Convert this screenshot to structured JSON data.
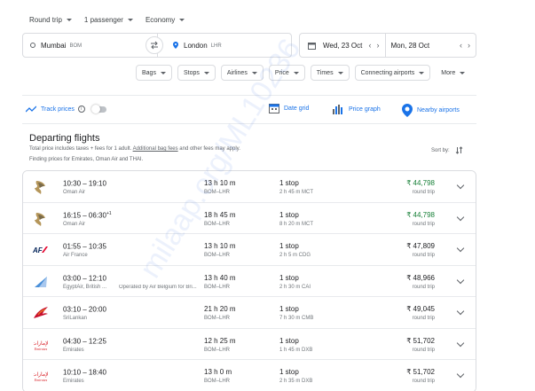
{
  "trip": {
    "type": "Round trip",
    "passengers": "1 passenger",
    "cabin": "Economy"
  },
  "search": {
    "origin_city": "Mumbai",
    "origin_code": "BOM",
    "dest_city": "London",
    "dest_code": "LHR",
    "depart_date": "Wed, 23 Oct",
    "return_date": "Mon, 28 Oct"
  },
  "filters": [
    "Bags",
    "Stops",
    "Airlines",
    "Price",
    "Times",
    "Connecting airports"
  ],
  "more_label": "More",
  "tools": {
    "track_prices": "Track prices",
    "date_grid": "Date grid",
    "price_graph": "Price graph",
    "nearby_airports": "Nearby airports"
  },
  "results": {
    "heading": "Departing flights",
    "note_prefix": "Total price includes taxes + fees for 1 adult.",
    "note_link": "Additional bag fees",
    "note_suffix": "and other fees may apply.",
    "note2": "Finding prices for Emirates, Oman Air and THAI.",
    "sort_label": "Sort by:"
  },
  "flights": [
    {
      "time": "10:30 – 19:10",
      "plus": "",
      "airline": "Oman Air",
      "operated": "",
      "duration": "13 h 10 m",
      "route": "BOM–LHR",
      "stops": "1 stop",
      "layover": "2 h 45 m MCT",
      "price": "₹ 44,798",
      "low": true,
      "price_note": "round trip",
      "logo": "omanair"
    },
    {
      "time": "16:15 – 06:30",
      "plus": "+1",
      "airline": "Oman Air",
      "operated": "",
      "duration": "18 h 45 m",
      "route": "BOM–LHR",
      "stops": "1 stop",
      "layover": "8 h 20 m MCT",
      "price": "₹ 44,798",
      "low": true,
      "price_note": "round trip",
      "logo": "omanair"
    },
    {
      "time": "01:55 – 10:35",
      "plus": "",
      "airline": "Air France",
      "operated": "",
      "duration": "13 h 10 m",
      "route": "BOM–LHR",
      "stops": "1 stop",
      "layover": "2 h 5 m CDG",
      "price": "₹ 47,809",
      "low": false,
      "price_note": "round trip",
      "logo": "airfrance"
    },
    {
      "time": "03:00 – 12:10",
      "plus": "",
      "airline": "EgyptAir, British ...",
      "operated": "Operated by Air Belgium for Bri...",
      "duration": "13 h 40 m",
      "route": "BOM–LHR",
      "stops": "1 stop",
      "layover": "2 h 30 m CAI",
      "price": "₹ 48,966",
      "low": false,
      "price_note": "round trip",
      "logo": "egyptair"
    },
    {
      "time": "03:10 – 20:00",
      "plus": "",
      "airline": "SriLankan",
      "operated": "",
      "duration": "21 h 20 m",
      "route": "BOM–LHR",
      "stops": "1 stop",
      "layover": "7 h 30 m CMB",
      "price": "₹ 49,045",
      "low": false,
      "price_note": "round trip",
      "logo": "srilankan"
    },
    {
      "time": "04:30 – 12:25",
      "plus": "",
      "airline": "Emirates",
      "operated": "",
      "duration": "12 h 25 m",
      "route": "BOM–LHR",
      "stops": "1 stop",
      "layover": "1 h 45 m DXB",
      "price": "₹ 51,702",
      "low": false,
      "price_note": "round trip",
      "logo": "emirates"
    },
    {
      "time": "10:10 – 18:40",
      "plus": "",
      "airline": "Emirates",
      "operated": "",
      "duration": "13 h 0 m",
      "route": "BOM–LHR",
      "stops": "1 stop",
      "layover": "2 h 35 m DXB",
      "price": "₹ 51,702",
      "low": false,
      "price_note": "round trip",
      "logo": "emirates"
    }
  ],
  "watermark": "milaap.org/ML10236",
  "colors": {
    "accent": "#1a73e8",
    "low_price": "#188038"
  }
}
